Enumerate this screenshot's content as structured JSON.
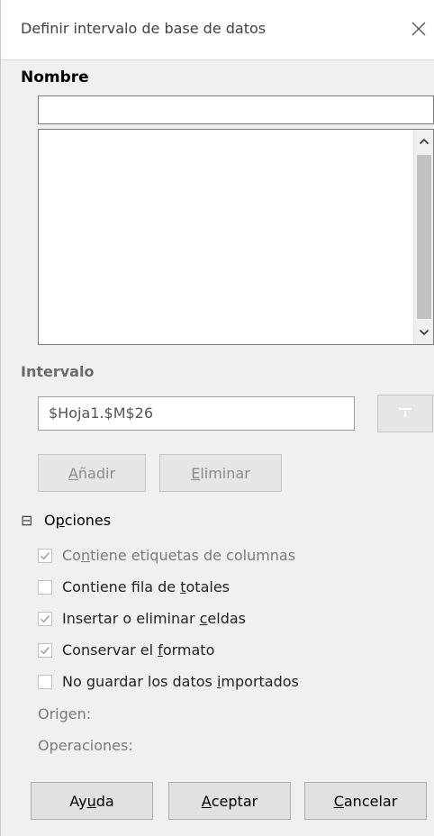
{
  "window": {
    "title": "Definir intervalo de base de datos"
  },
  "name_section": {
    "label": "Nombre",
    "input_value": "",
    "list_items": []
  },
  "range_section": {
    "label": "Intervalo",
    "value": "$Hoja1.$M$26"
  },
  "buttons": {
    "add": {
      "pre": "",
      "u": "A",
      "post": "ñadir"
    },
    "remove": {
      "pre": "",
      "u": "E",
      "post": "liminar"
    },
    "help": {
      "pre": "Ay",
      "u": "u",
      "post": "da"
    },
    "ok": {
      "pre": "",
      "u": "A",
      "post": "ceptar"
    },
    "cancel": {
      "pre": "",
      "u": "C",
      "post": "ancelar"
    }
  },
  "options": {
    "header": {
      "pre": "O",
      "u": "p",
      "post": "ciones"
    },
    "collapse_symbol": "⊟",
    "items": [
      {
        "pre": "Co",
        "u": "n",
        "post": "tiene etiquetas de columnas",
        "checked": true
      },
      {
        "pre": "Contiene fila de ",
        "u": "t",
        "post": "otales",
        "checked": false
      },
      {
        "pre": "Insertar o eliminar ",
        "u": "c",
        "post": "eldas",
        "checked": true
      },
      {
        "pre": "Conservar el ",
        "u": "f",
        "post": "ormato",
        "checked": true
      },
      {
        "pre": "No guardar los datos ",
        "u": "i",
        "post": "mportados",
        "checked": false
      }
    ],
    "source_label": "Origen:",
    "operations_label": "Operaciones:"
  },
  "icons": {
    "close": "close-icon",
    "shrink": "shrink-icon",
    "scroll_up": "chevron-up-icon",
    "scroll_down": "chevron-down-icon"
  }
}
